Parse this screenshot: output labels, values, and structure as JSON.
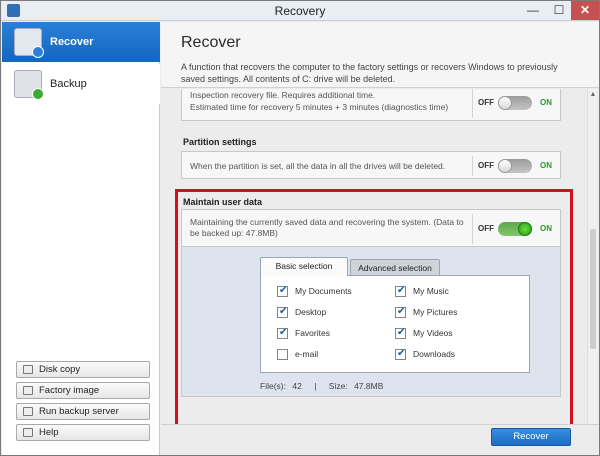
{
  "window": {
    "title": "Recovery",
    "minimize_glyph": "—",
    "maximize_glyph": "☐",
    "close_glyph": "✕"
  },
  "sidebar": {
    "items": [
      {
        "label": "Recover",
        "icon": "recover-icon",
        "active": true
      },
      {
        "label": "Backup",
        "icon": "backup-icon",
        "active": false
      }
    ],
    "buttons": [
      {
        "label": "Disk copy",
        "icon": "disk-copy-icon"
      },
      {
        "label": "Factory image",
        "icon": "factory-image-icon"
      },
      {
        "label": "Run backup server",
        "icon": "backup-server-icon"
      },
      {
        "label": "Help",
        "icon": "help-icon"
      }
    ]
  },
  "main": {
    "title": "Recover",
    "description": "A function that recovers the computer to the factory settings or recovers Windows to previously saved settings. All contents of C: drive will be deleted.",
    "inspection_card": {
      "line1": "Inspection recovery file. Requires additional time.",
      "line2": "Estimated time for recovery 5 minutes + 3 minutes (diagnostics time)",
      "toggle_off": "OFF",
      "toggle_on": "ON",
      "state": "off"
    },
    "partition": {
      "title": "Partition settings",
      "text": "When the partition is set, all the data in all the drives will be deleted.",
      "toggle_off": "OFF",
      "toggle_on": "ON",
      "state": "off"
    },
    "maintain": {
      "title": "Maintain user data",
      "text": "Maintaining the currently saved data and recovering the system. (Data to be backed up: 47.8MB)",
      "toggle_off": "OFF",
      "toggle_on": "ON",
      "state": "on"
    },
    "tabs": [
      {
        "label": "Basic selection",
        "active": true
      },
      {
        "label": "Advanced selection",
        "active": false
      }
    ],
    "checklist_left": [
      {
        "label": "My Documents",
        "checked": true
      },
      {
        "label": "Desktop",
        "checked": true
      },
      {
        "label": "Favorites",
        "checked": true
      },
      {
        "label": "e-mail",
        "checked": false
      }
    ],
    "checklist_right": [
      {
        "label": "My Music",
        "checked": true
      },
      {
        "label": "My Pictures",
        "checked": true
      },
      {
        "label": "My Videos",
        "checked": true
      },
      {
        "label": "Downloads",
        "checked": true
      }
    ],
    "summary": {
      "files_label": "File(s):",
      "files_value": "42",
      "separator": "|",
      "size_label": "Size:",
      "size_value": "47.8MB"
    },
    "recover_button": "Recover"
  },
  "colors": {
    "accent": "#1a6cc4",
    "highlight_border": "#d40f1b",
    "toggle_on": "#3aa52a"
  }
}
